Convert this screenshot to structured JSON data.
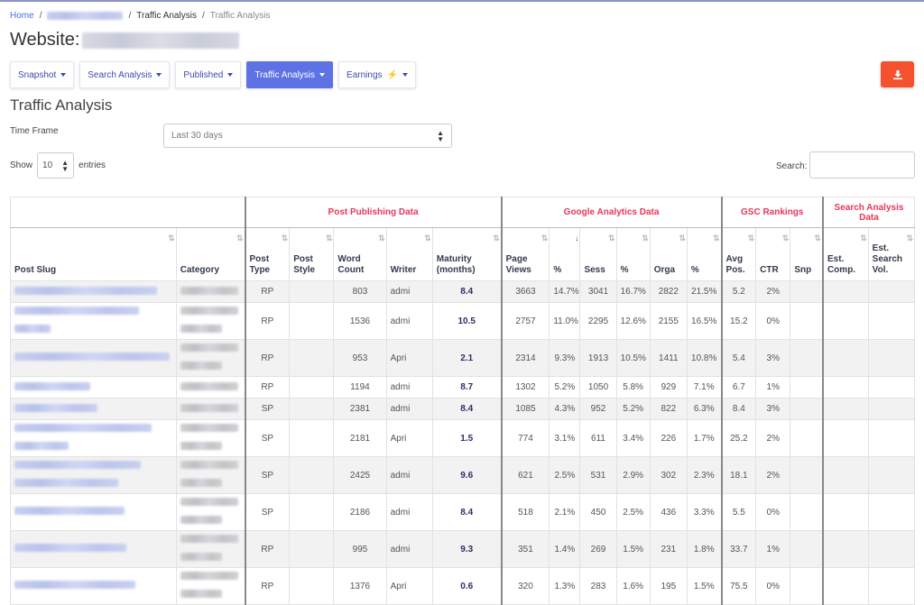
{
  "breadcrumb": {
    "home": "Home",
    "sep": "/",
    "item2": "Traffic Analysis",
    "item3": "Traffic Analysis"
  },
  "page": {
    "title_prefix": "Website:"
  },
  "tabs": [
    {
      "label": "Snapshot"
    },
    {
      "label": "Search Analysis"
    },
    {
      "label": "Published"
    },
    {
      "label": "Traffic Analysis",
      "active": true
    },
    {
      "label": "Earnings"
    }
  ],
  "section_title": "Traffic Analysis",
  "time_frame": {
    "label": "Time Frame",
    "value": "Last 30 days"
  },
  "show_entries": {
    "show": "Show",
    "value": "10",
    "entries": "entries"
  },
  "search": {
    "label": "Search:"
  },
  "colors": {
    "accent": "#5e72e4",
    "group_header": "#e8365a",
    "download": "#f5512f"
  },
  "table": {
    "groups": [
      "Post Publishing Data",
      "Google Analytics Data",
      "GSC Rankings",
      "Search Analysis Data"
    ],
    "headers": [
      "Post Slug",
      "Category",
      "Post Type",
      "Post Style",
      "Word Count",
      "Writer",
      "Maturity (months)",
      "Page Views",
      "%",
      "Sess",
      "%",
      "Orga",
      "%",
      "Avg Pos.",
      "CTR",
      "Snp",
      "Est. Comp.",
      "Est. Search Vol."
    ],
    "rows": [
      [
        "RP",
        "",
        "803",
        "admi",
        "8.4",
        "3663",
        "14.7%",
        "3041",
        "16.7%",
        "2822",
        "21.5%",
        "5.2",
        "2%",
        "",
        "",
        ""
      ],
      [
        "RP",
        "",
        "1536",
        "admi",
        "10.5",
        "2757",
        "11.0%",
        "2295",
        "12.6%",
        "2155",
        "16.5%",
        "15.2",
        "0%",
        "",
        "",
        ""
      ],
      [
        "RP",
        "",
        "953",
        "Apri",
        "2.1",
        "2314",
        "9.3%",
        "1913",
        "10.5%",
        "1411",
        "10.8%",
        "5.4",
        "3%",
        "",
        "",
        ""
      ],
      [
        "RP",
        "",
        "1194",
        "admi",
        "8.7",
        "1302",
        "5.2%",
        "1050",
        "5.8%",
        "929",
        "7.1%",
        "6.7",
        "1%",
        "",
        "",
        ""
      ],
      [
        "SP",
        "",
        "2381",
        "admi",
        "8.4",
        "1085",
        "4.3%",
        "952",
        "5.2%",
        "822",
        "6.3%",
        "8.4",
        "3%",
        "",
        "",
        ""
      ],
      [
        "SP",
        "",
        "2181",
        "Apri",
        "1.5",
        "774",
        "3.1%",
        "611",
        "3.4%",
        "226",
        "1.7%",
        "25.2",
        "2%",
        "",
        "",
        ""
      ],
      [
        "SP",
        "",
        "2425",
        "admi",
        "9.6",
        "621",
        "2.5%",
        "531",
        "2.9%",
        "302",
        "2.3%",
        "18.1",
        "2%",
        "",
        "",
        ""
      ],
      [
        "SP",
        "",
        "2186",
        "admi",
        "8.4",
        "518",
        "2.1%",
        "450",
        "2.5%",
        "436",
        "3.3%",
        "5.5",
        "0%",
        "",
        "",
        ""
      ],
      [
        "RP",
        "",
        "995",
        "admi",
        "9.3",
        "351",
        "1.4%",
        "269",
        "1.5%",
        "231",
        "1.8%",
        "33.7",
        "1%",
        "",
        "",
        ""
      ],
      [
        "RP",
        "",
        "1376",
        "Apri",
        "0.6",
        "320",
        "1.3%",
        "283",
        "1.6%",
        "195",
        "1.5%",
        "75.5",
        "0%",
        "",
        "",
        ""
      ]
    ]
  }
}
